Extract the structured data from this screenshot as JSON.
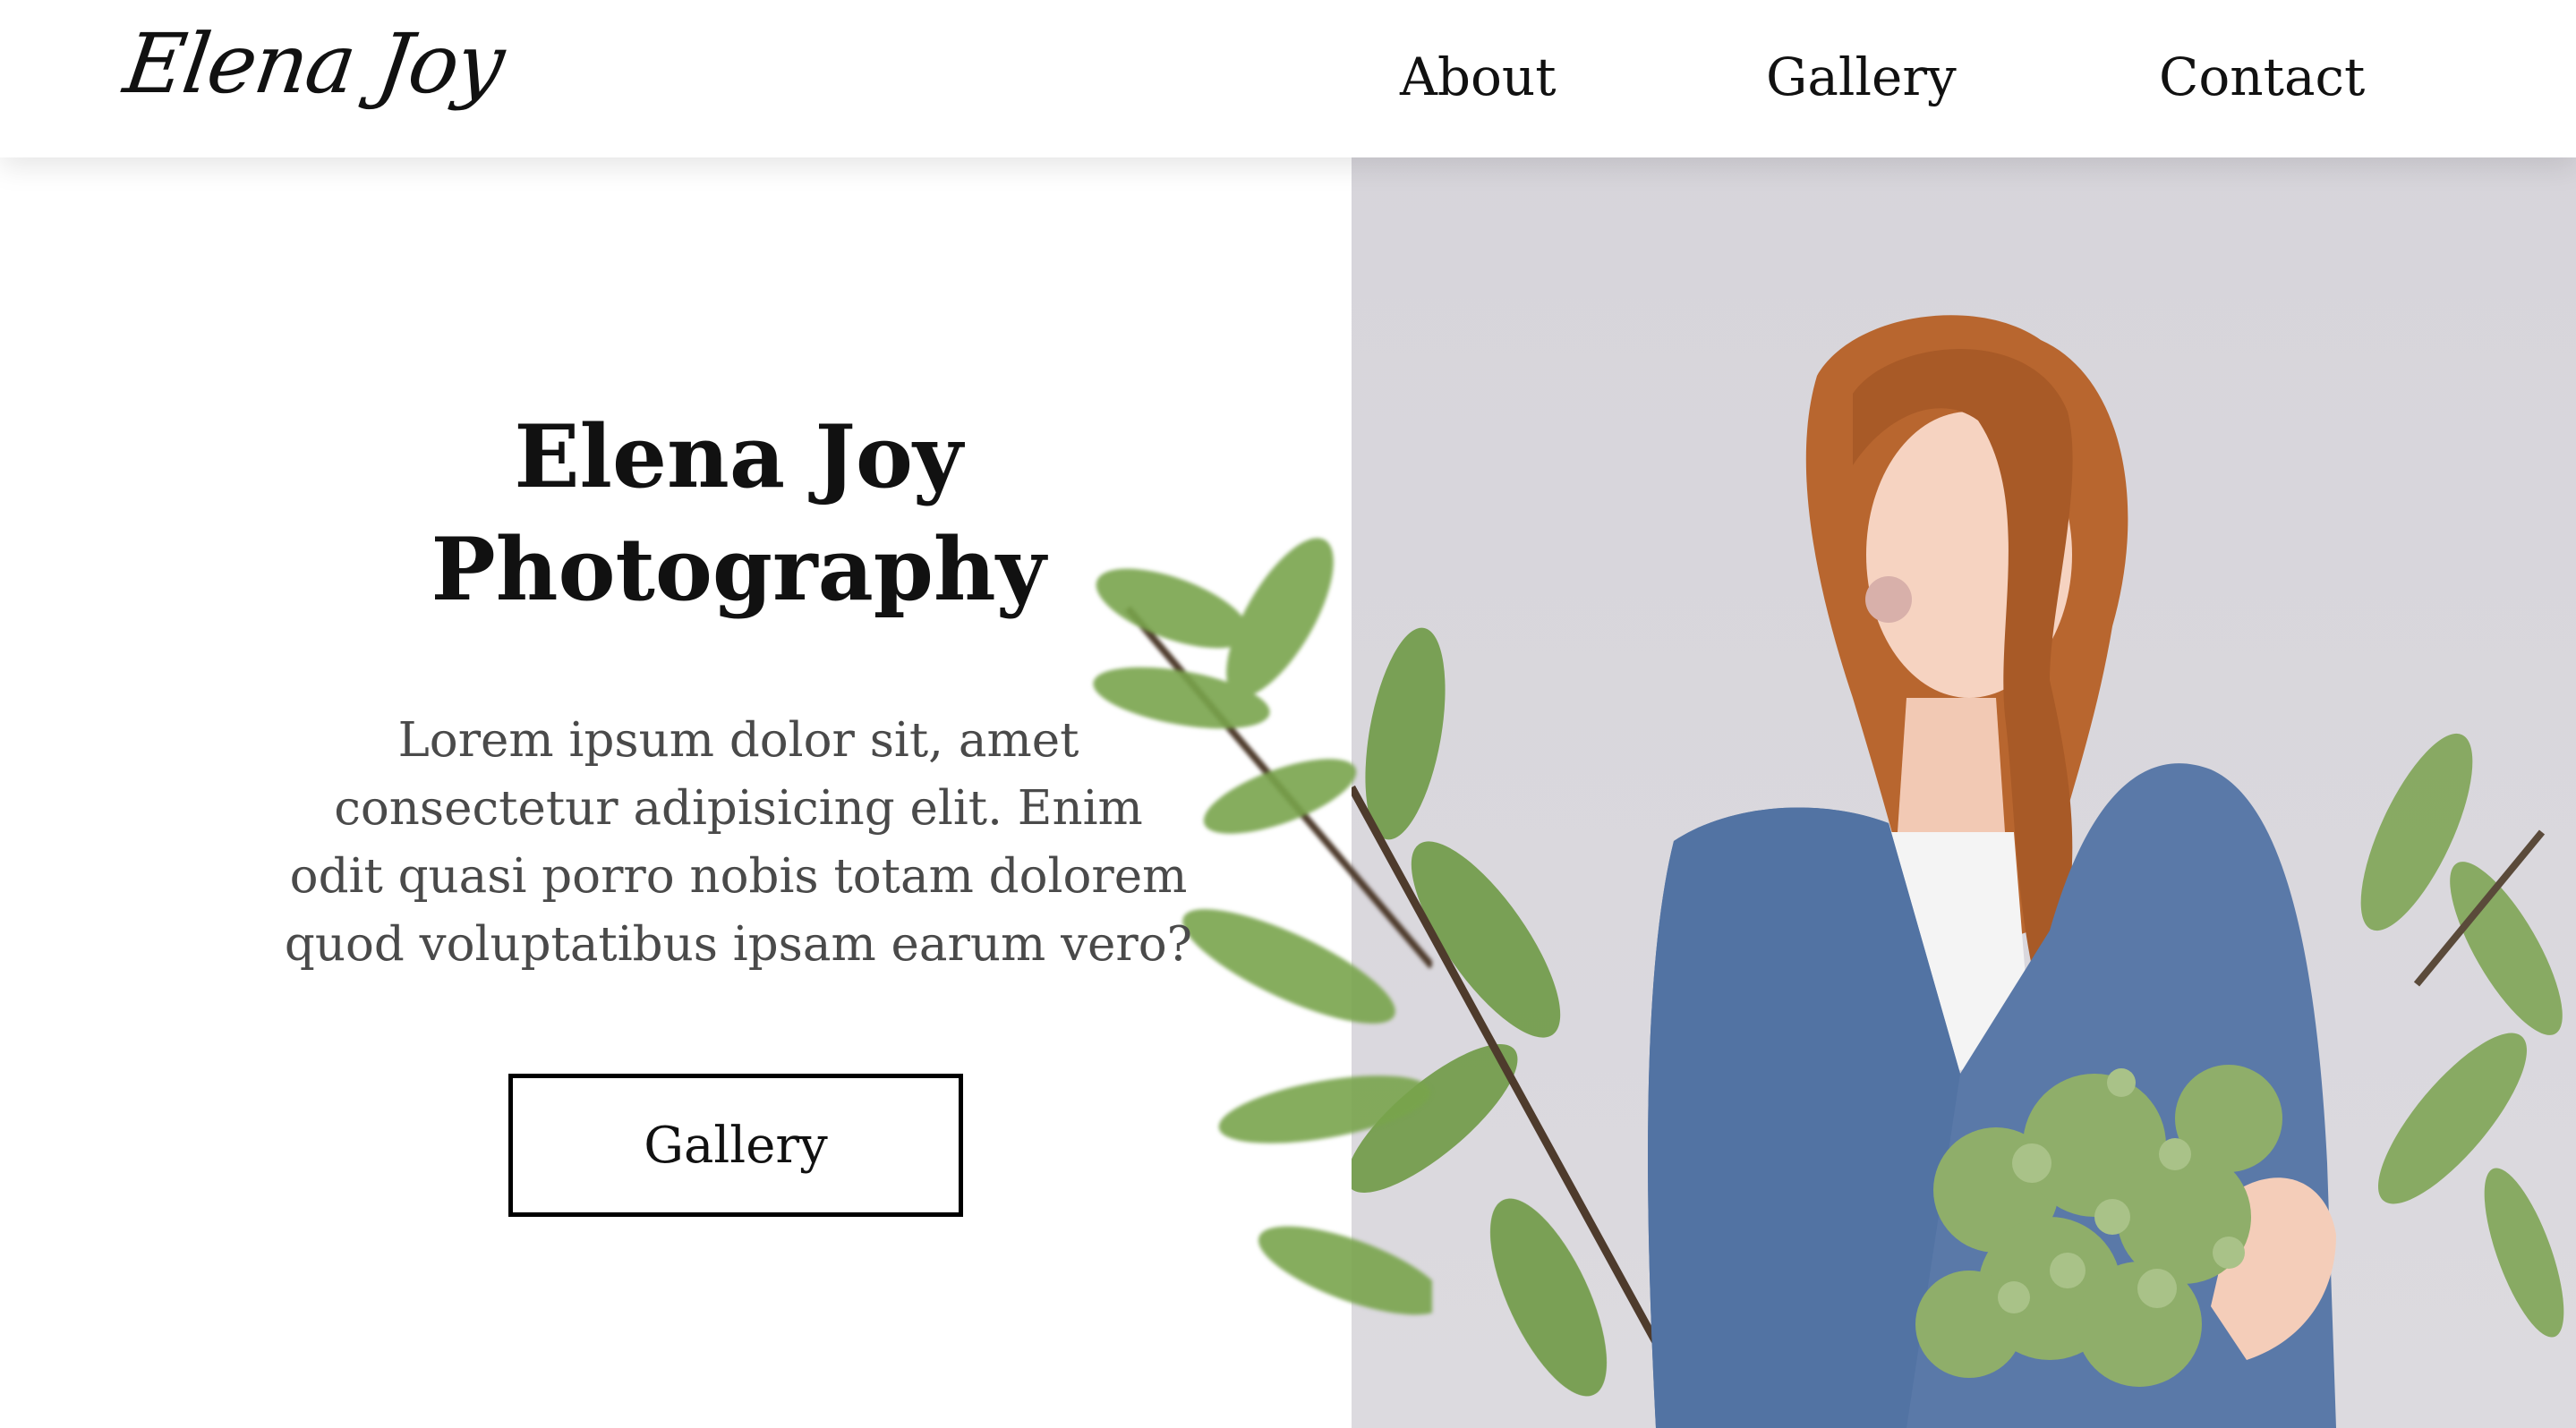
{
  "header": {
    "logo": "Elena Joy",
    "nav": [
      {
        "label": "About"
      },
      {
        "label": "Gallery"
      },
      {
        "label": "Contact"
      }
    ]
  },
  "hero": {
    "title_line1": "Elena Joy",
    "title_line2": "Photography",
    "text_lines": [
      "Lorem ipsum dolor sit, amet",
      "consectetur adipisicing elit. Enim",
      "odit quasi porro nobis totam dolorem",
      "quod voluptatibus ipsam earum vero?"
    ],
    "cta_label": "Gallery"
  },
  "colors": {
    "background": "#ffffff",
    "photo_backdrop": "#d9d7dc",
    "sweater": "#5a79a8",
    "hair": "#b8662f",
    "leaves": "#6f9a46"
  },
  "icons": {
    "logo": "script-wordmark",
    "photo": "portrait-woman-with-flowers"
  }
}
